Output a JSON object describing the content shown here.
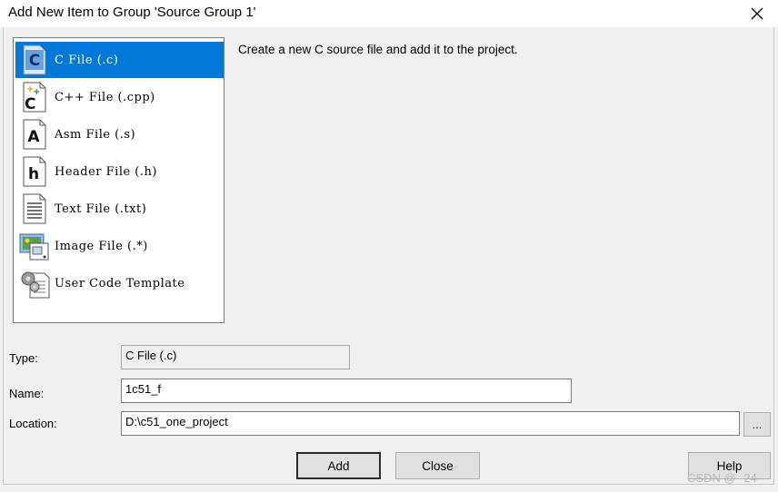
{
  "window": {
    "title": "Add New Item to Group 'Source Group 1'",
    "close_symbol": "✕"
  },
  "file_types": [
    {
      "label": "C File (.c)",
      "icon": "c-file-icon",
      "selected": true
    },
    {
      "label": "C++ File (.cpp)",
      "icon": "cpp-file-icon",
      "selected": false
    },
    {
      "label": "Asm File (.s)",
      "icon": "asm-file-icon",
      "selected": false
    },
    {
      "label": "Header File (.h)",
      "icon": "header-file-icon",
      "selected": false
    },
    {
      "label": "Text File (.txt)",
      "icon": "text-file-icon",
      "selected": false
    },
    {
      "label": "Image File (.*)",
      "icon": "image-file-icon",
      "selected": false
    },
    {
      "label": "User Code Template",
      "icon": "template-icon",
      "selected": false
    }
  ],
  "description": "Create a new C source file and add it to the project.",
  "form": {
    "type_label": "Type:",
    "type_value": "C File (.c)",
    "name_label": "Name:",
    "name_value": "1c51_f",
    "location_label": "Location:",
    "location_value": "D:\\c51_one_project",
    "browse_label": "..."
  },
  "buttons": {
    "add": "Add",
    "close": "Close",
    "help": "Help"
  },
  "watermark": "CSDN @--24",
  "colors": {
    "selection": "#0078d7",
    "dialog_bg": "#f0f0f0"
  }
}
